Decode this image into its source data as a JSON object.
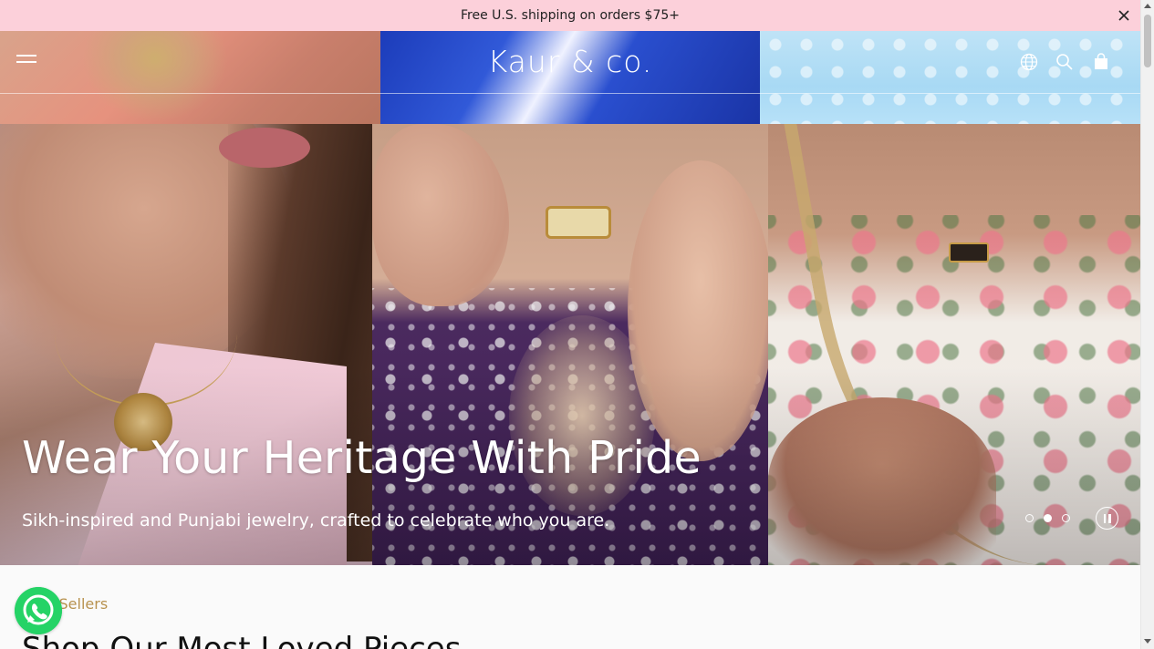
{
  "announcement": {
    "text": "Free U.S. shipping on orders $75+",
    "close_icon": "close-icon"
  },
  "header": {
    "logo": "Kaur & co.",
    "icons": [
      "menu-icon",
      "globe-icon",
      "search-icon",
      "bag-icon"
    ]
  },
  "hero": {
    "title": "Wear Your Heritage With Pride",
    "subtitle": "Sikh-inspired and Punjabi jewelry, crafted to celebrate who you are.",
    "slides": 3,
    "active_slide": 2
  },
  "section": {
    "eyebrow": "Best Sellers",
    "title": "Shop Our Most Loved Pieces"
  },
  "colors": {
    "announcement_bg": "#fcd0da",
    "accent_gold": "#b8924f",
    "whatsapp": "#25d366"
  }
}
